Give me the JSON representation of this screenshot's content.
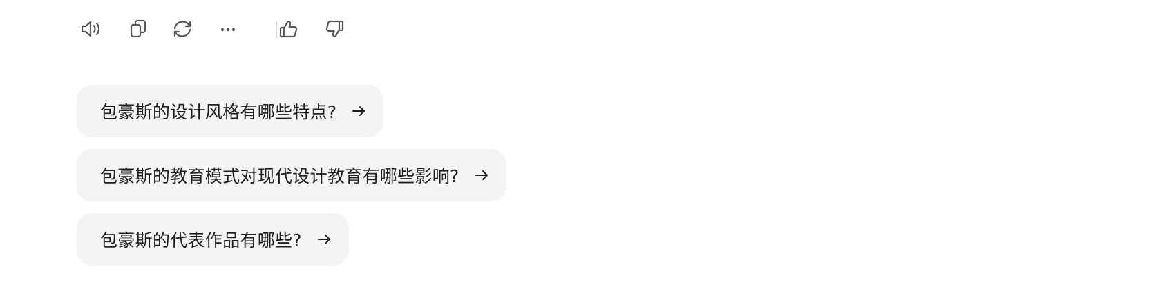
{
  "toolbar": {
    "icons": [
      "speaker-icon",
      "copy-icon",
      "regenerate-icon",
      "more-icon",
      "thumbs-up-icon",
      "thumbs-down-icon"
    ],
    "icon_color": "#555555"
  },
  "suggestions": [
    {
      "label": "包豪斯的设计风格有哪些特点?",
      "icon": "arrow-right-icon"
    },
    {
      "label": "包豪斯的教育模式对现代设计教育有哪些影响?",
      "icon": "arrow-right-icon"
    },
    {
      "label": "包豪斯的代表作品有哪些?",
      "icon": "arrow-right-icon"
    }
  ],
  "colors": {
    "chip_background": "#f4f4f4",
    "chip_text": "#1f1f1f",
    "divider": "#d8d8d8"
  }
}
